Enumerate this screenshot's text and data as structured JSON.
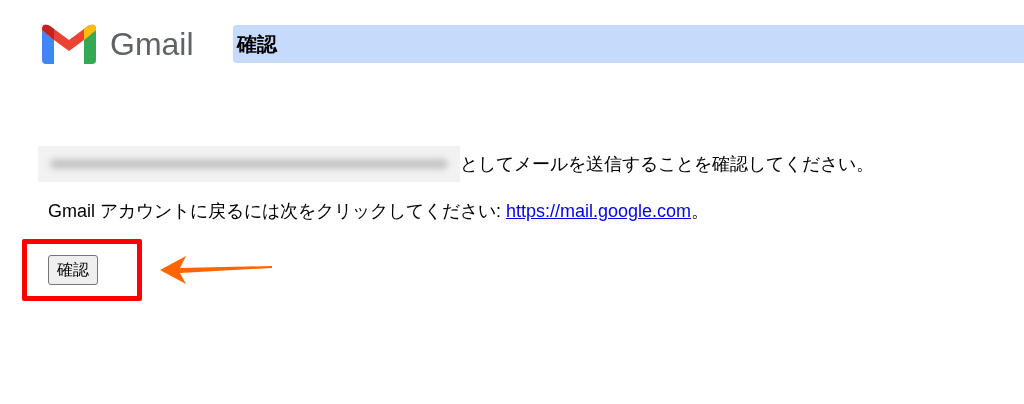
{
  "header": {
    "brand": "Gmail",
    "title": "確認"
  },
  "message": {
    "email": {
      "kind": "redacted"
    },
    "sentence": "としてメールを送信することを確認してください。"
  },
  "return_line": {
    "text": "Gmail アカウントに戻るには次をクリックしてください: ",
    "link": "https://mail.google.com",
    "suffix": "。"
  },
  "confirm_button": {
    "label": "確認"
  }
}
